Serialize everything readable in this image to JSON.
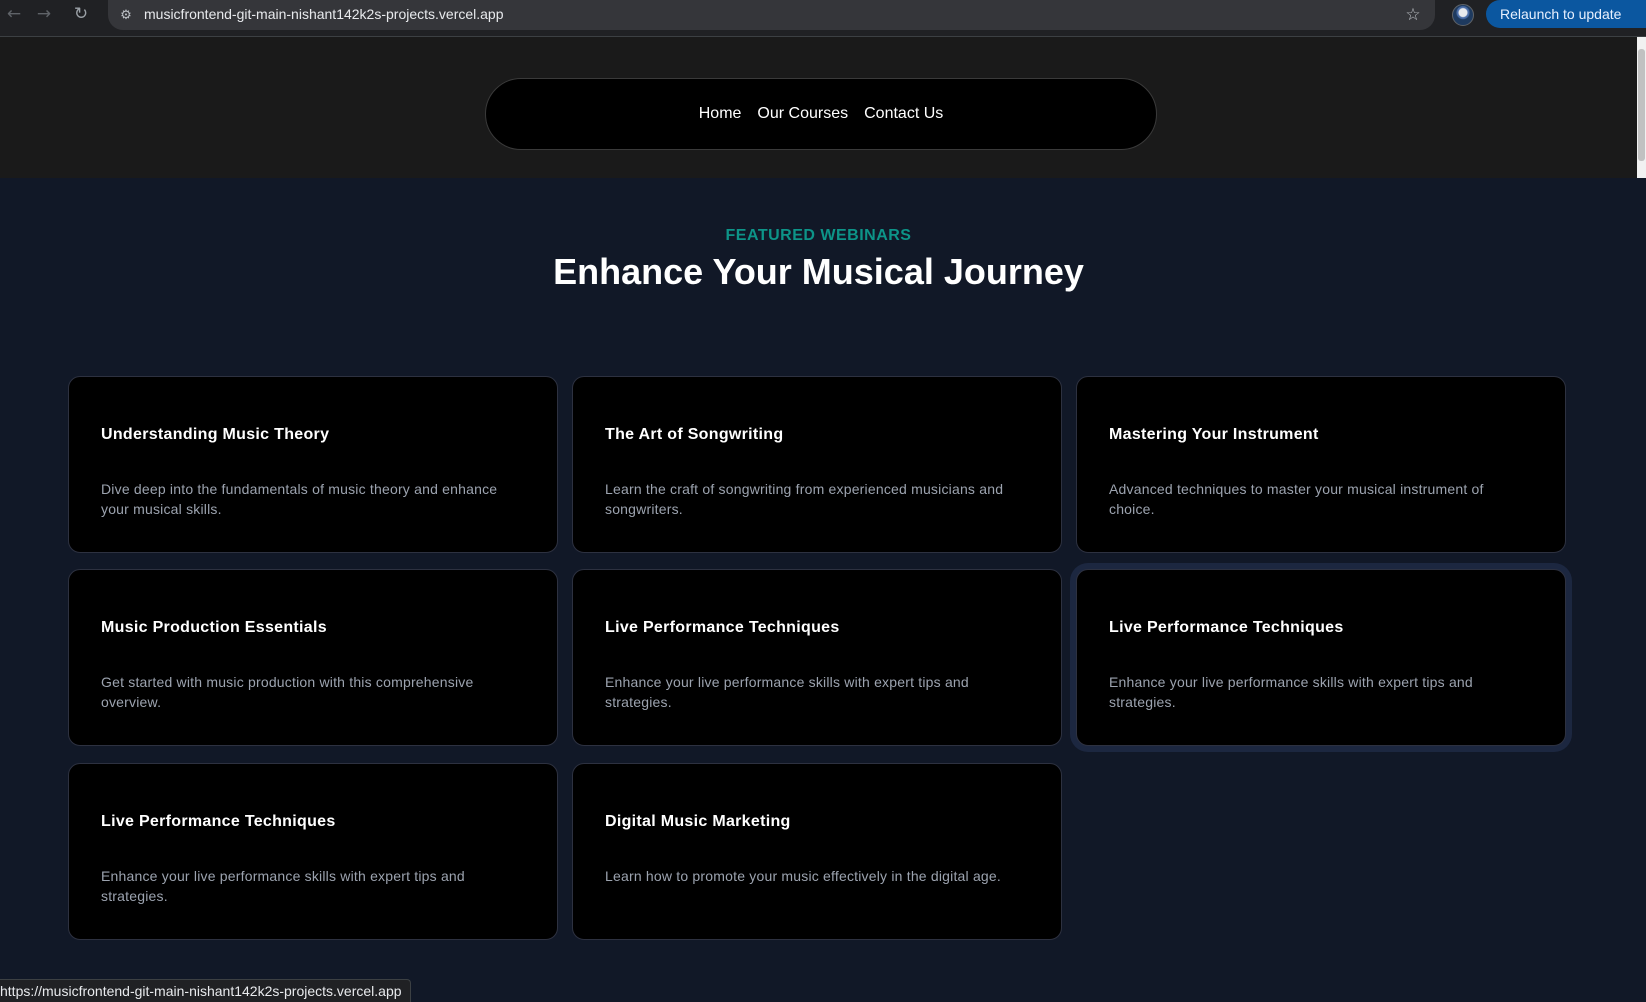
{
  "browser": {
    "url": "musicfrontend-git-main-nishant142k2s-projects.vercel.app",
    "relaunch_label": "Relaunch to update",
    "status_url": "https://musicfrontend-git-main-nishant142k2s-projects.vercel.app",
    "icons": [
      "back-icon",
      "forward-icon",
      "reload-icon",
      "site-info-icon",
      "star-icon",
      "profile-avatar"
    ]
  },
  "nav": {
    "items": [
      {
        "label": "Home"
      },
      {
        "label": "Our Courses"
      },
      {
        "label": "Contact Us"
      }
    ]
  },
  "hero": {
    "eyebrow": "FEATURED WEBINARS",
    "title": "Enhance Your Musical Journey"
  },
  "webinars": [
    {
      "title": "Understanding Music Theory",
      "description": "Dive deep into the fundamentals of music theory and enhance your musical skills."
    },
    {
      "title": "The Art of Songwriting",
      "description": "Learn the craft of songwriting from experienced musicians and songwriters."
    },
    {
      "title": "Mastering Your Instrument",
      "description": "Advanced techniques to master your musical instrument of choice."
    },
    {
      "title": "Music Production Essentials",
      "description": "Get started with music production with this comprehensive overview."
    },
    {
      "title": "Live Performance Techniques",
      "description": "Enhance your live performance skills with expert tips and strategies."
    },
    {
      "title": "Live Performance Techniques",
      "description": "Enhance your live performance skills with expert tips and strategies."
    },
    {
      "title": "Live Performance Techniques",
      "description": "Enhance your live performance skills with expert tips and strategies."
    },
    {
      "title": "Digital Music Marketing",
      "description": "Learn how to promote your music effectively in the digital age."
    }
  ],
  "colors": {
    "page_bg": "#111827",
    "header_bg": "#1a1a1a",
    "accent": "#0d9488",
    "card_bg": "#000000",
    "card_text": "#9ca3af"
  }
}
